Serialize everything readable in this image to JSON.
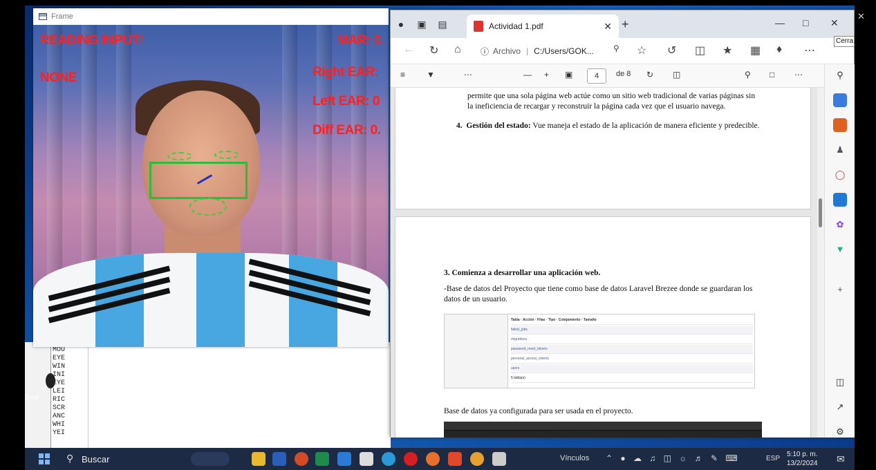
{
  "frame": {
    "title": "Frame",
    "overlays": {
      "reading": "READING INPUT!",
      "none": "NONE",
      "mar": "MAR: 0.",
      "right_ear": "Right EAR:",
      "left_ear": "Left EAR: 0",
      "diff_ear": "Diff EAR: 0."
    }
  },
  "editor": {
    "lines": [
      "MOU",
      "EYE",
      "WIN",
      "INI",
      "EYE",
      "LEI",
      "RIC",
      "SCR",
      "ANC",
      "WHI",
      "YEI"
    ],
    "drive_label": "Drive"
  },
  "browser": {
    "tab_title": "Actividad 1.pdf",
    "address_label": "Archivo",
    "address_url": "C:/Users/GOK...",
    "page_current": "4",
    "page_total": "de 8",
    "tooltip": "Cerra"
  },
  "pdf": {
    "page1_lines": [
      "permite que una sola página web actúe como un sitio web tradicional de varias páginas sin",
      "la ineficiencia de recargar y reconstruir la página cada vez que el usuario navega."
    ],
    "item4_number": "4.",
    "item4_bold": "Gestión del estado:",
    "item4_text": "Vue maneja el estado de la aplicación de manera eficiente y predecible.",
    "heading": "3. Comienza a desarrollar una aplicación web.",
    "para_lines": [
      "-Base de datos del Proyecto que tiene como base de datos Laravel Brezee donde se guardaran los",
      "datos de un usuario."
    ],
    "db_tables": [
      "failed_jobs",
      "migrations",
      "password_reset_tokens",
      "personal_access_tokens",
      "users",
      "5 tabla(s)"
    ],
    "caption": "Base de datos ya configurada para ser usada en el proyecto."
  },
  "taskbar": {
    "search": "Buscar",
    "links": "Vínculos",
    "lang": "ESP",
    "time": "5:10 p. m.",
    "date": "13/2/2024"
  }
}
